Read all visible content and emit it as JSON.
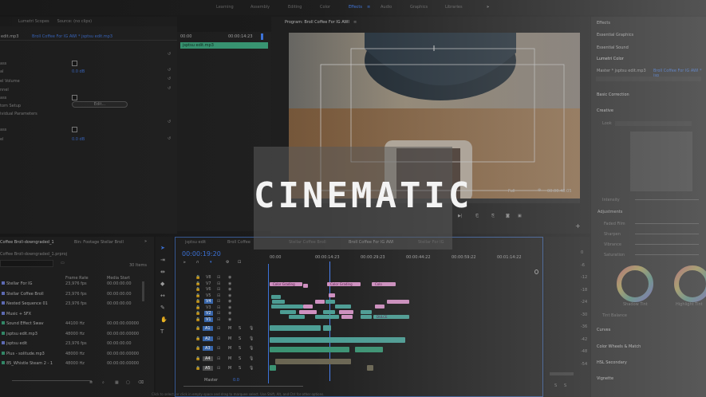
{
  "workspaces": [
    "Learning",
    "Assembly",
    "Editing",
    "Color",
    "Effects",
    "Audio",
    "Graphics",
    "Libraries"
  ],
  "workspace_active": "Effects",
  "more_workspaces": "»",
  "source_panel": {
    "tabs": [
      "Lumetri Scopes",
      "Source: (no clips)"
    ],
    "clip_tab_left": "edit.mp3",
    "clip_tab_right": "Broll Coffee For IG AWI * jsptsu edit.mp3",
    "mini_ruler": {
      "start": "00:00",
      "end": "00:00:14:23"
    },
    "mini_clip": "jsptsu edit.mp3",
    "rows": [
      {
        "label": "ass",
        "value": ""
      },
      {
        "label": "al",
        "value": "0.0  dB"
      },
      {
        "label": "el Volume",
        "value": ""
      },
      {
        "label": "nnel",
        "value": ""
      },
      {
        "label": "ass",
        "value": ""
      },
      {
        "label": "tom Setup",
        "value": "Edit..."
      },
      {
        "label": "ividual Parameters",
        "value": ""
      },
      {
        "label": "ass",
        "value": ""
      },
      {
        "label": "el",
        "value": "0.0  dB"
      }
    ]
  },
  "program": {
    "title": "Program: Broll Coffee For IG AWI",
    "timecode": "00:00:48:05",
    "fit": "Full"
  },
  "project": {
    "tabs": [
      "Coffee Broll-downgraded_1",
      "Bin: Footage Stellar Broll"
    ],
    "path": "Coffee Broll-downgraded_1.prproj",
    "count": "30 Items",
    "columns": [
      "Frame Rate",
      "Media Start"
    ],
    "items": [
      {
        "name": "Stellar For IG",
        "fps": "23,976 fps",
        "start": "00:00:00:00"
      },
      {
        "name": "Stellar Coffee Broll",
        "fps": "23,976 fps",
        "start": "00:00:00:00"
      },
      {
        "name": "Nested Sequence 01",
        "fps": "23,976 fps",
        "start": "00:00:00:00"
      },
      {
        "name": "Music + SFX",
        "fps": "",
        "start": ""
      },
      {
        "name": "Sound Effect Swav",
        "fps": "44100 Hz",
        "start": "00:00:00:00000"
      },
      {
        "name": "jsptsu edit.mp3",
        "fps": "48000 Hz",
        "start": "00:00:00:00000"
      },
      {
        "name": "jsptsu edit",
        "fps": "23,976 fps",
        "start": "00:00:00:00"
      },
      {
        "name": "Plus - solitude.mp3",
        "fps": "48000 Hz",
        "start": "00:00:00:00000"
      },
      {
        "name": "85_Whistle Steam 2 - 1",
        "fps": "48000 Hz",
        "start": "00:00:00:00000"
      }
    ]
  },
  "timeline": {
    "tabs": [
      "jsptsu edit",
      "Broll Coffee",
      "Stellar Coffee Broll",
      "Broll Coffee For IG AWI",
      "Stellar For IG"
    ],
    "timecode": "00:00:19:20",
    "ruler": [
      "00:00",
      "00:00:14:23",
      "00:00:29:23",
      "00:00:44:22",
      "00:00:59:22",
      "00:01:14:22"
    ],
    "video_tracks": [
      "V8",
      "V7",
      "V6",
      "V5",
      "V4",
      "V3",
      "V2",
      "V1"
    ],
    "audio_tracks": [
      "A1",
      "A2",
      "A3",
      "A4",
      "A5"
    ],
    "master_label": "Master",
    "master_value": "0.0",
    "fx_clip": "Color Grading",
    "fx_clip_short": "Colo",
    "chip": "DULCE"
  },
  "meters": {
    "scale": [
      "0",
      "-6",
      "-12",
      "-18",
      "-24",
      "-30",
      "-36",
      "-42",
      "-48",
      "-54"
    ],
    "foot": [
      "S",
      "S"
    ]
  },
  "lumetri": {
    "sections": [
      "Effects",
      "Essential Graphics",
      "Essential Sound",
      "Lumetri Color"
    ],
    "master": "Master * jsptsu edit.mp3",
    "seq": "Broll Coffee For IG AWI * jsp",
    "groups": [
      "Basic Correction",
      "Creative",
      "Curves",
      "Color Wheels & Match",
      "HSL Secondary",
      "Vignette"
    ],
    "creative_items": [
      "Look",
      "Intensity"
    ],
    "adjust": "Adjustments",
    "adjust_items": [
      "Faded Film",
      "Sharpen",
      "Vibrance",
      "Saturation"
    ],
    "wheels": [
      "Shadow Tint",
      "Highlight Tint"
    ],
    "tint_balance": "Tint Balance"
  },
  "title_card": "CINEMATIC",
  "status_bar": "Click to select, or click in empty space and drag to marquee select. Use Shift, Alt, and Ctrl for other options."
}
